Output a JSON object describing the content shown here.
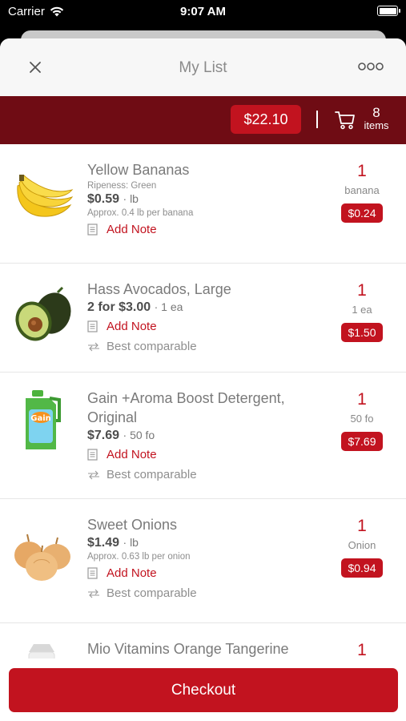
{
  "status": {
    "carrier": "Carrier",
    "time": "9:07 AM"
  },
  "nav": {
    "title": "My List"
  },
  "summary": {
    "total": "$22.10",
    "count": "8",
    "count_label": "items"
  },
  "items": [
    {
      "name": "Yellow Bananas",
      "sub": "Ripeness: Green",
      "price": "$0.59",
      "price_unit": "lb",
      "approx": "Approx. 0.4 lb per banana",
      "note": "Add Note",
      "qty": "1",
      "unit": "banana",
      "cost": "$0.24"
    },
    {
      "name": "Hass Avocados, Large",
      "price": "2 for $3.00",
      "price_unit": "1 ea",
      "note": "Add Note",
      "compare": "Best comparable",
      "qty": "1",
      "unit": "1 ea",
      "cost": "$1.50"
    },
    {
      "name": "Gain +Aroma Boost Detergent, Original",
      "price": "$7.69",
      "price_unit": "50 fo",
      "note": "Add Note",
      "compare": "Best comparable",
      "qty": "1",
      "unit": "50 fo",
      "cost": "$7.69"
    },
    {
      "name": "Sweet Onions",
      "price": "$1.49",
      "price_unit": "lb",
      "approx": "Approx. 0.63 lb per onion",
      "note": "Add Note",
      "compare": "Best comparable",
      "qty": "1",
      "unit": "Onion",
      "cost": "$0.94"
    },
    {
      "name": "Mio Vitamins Orange Tangerine",
      "qty": "1"
    }
  ],
  "checkout": {
    "label": "Checkout"
  },
  "colors": {
    "brand": "#c2131f",
    "header_bar": "#6f0c14"
  }
}
